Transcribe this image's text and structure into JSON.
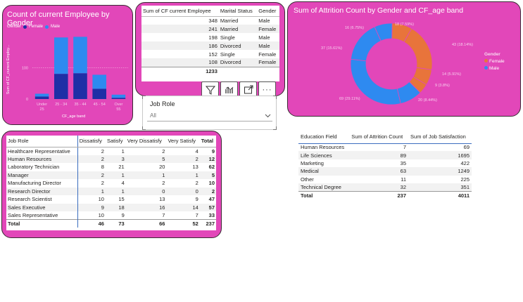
{
  "gender_chart": {
    "title": "Count of current Employee by Gender",
    "legend_title": "Gender",
    "legend": [
      {
        "name": "Female",
        "color": "#1f2fa6"
      },
      {
        "name": "Male",
        "color": "#2e8af0"
      }
    ],
    "ylabel": "Sum of CF_current Employ...",
    "xlabel": "CF_age band",
    "ytick_100": "100",
    "ytick_0": "0",
    "chart_data": {
      "type": "bar",
      "stacked": true,
      "title": "Count of current Employee by Gender",
      "xlabel": "CF_age band",
      "ylabel": "Sum of CF_current Employ...",
      "categories": [
        "Under 25",
        "25 - 34",
        "35 - 44",
        "45 - 54",
        "Over 55"
      ],
      "category_lines": [
        [
          "Under",
          "25"
        ],
        [
          "25 - 34",
          ""
        ],
        [
          "35 - 44",
          ""
        ],
        [
          "45 - 54",
          ""
        ],
        [
          "Over",
          "55"
        ]
      ],
      "series": [
        {
          "name": "Female",
          "color": "#1f2fa6",
          "values": [
            8,
            81,
            83,
            33,
            4
          ]
        },
        {
          "name": "Male",
          "color": "#2e8af0",
          "values": [
            9,
            117,
            117,
            45,
            10
          ]
        }
      ],
      "ylim": [
        0,
        210
      ],
      "grid": false,
      "legend_position": "top-left"
    }
  },
  "marital_table": {
    "headers": [
      "Sum of CF current Employee",
      "Marital Status",
      "Gender"
    ],
    "rows": [
      [
        "348",
        "Married",
        "Male"
      ],
      [
        "241",
        "Married",
        "Female"
      ],
      [
        "198",
        "Single",
        "Male"
      ],
      [
        "186",
        "Divorced",
        "Male"
      ],
      [
        "152",
        "Single",
        "Female"
      ],
      [
        "108",
        "Divorced",
        "Female"
      ]
    ],
    "total": "1233"
  },
  "visual_toolbar": {
    "filter_icon": "filter-icon",
    "analytics_icon": "analytics-icon",
    "focus_icon": "focus-mode-icon",
    "more_icon": "more-options-icon",
    "more_label": "···"
  },
  "attrition_chart": {
    "title": "Sum of Attrition Count by Gender and CF_age band",
    "legend_title": "Gender",
    "legend": [
      {
        "name": "Female",
        "color": "#e8743b"
      },
      {
        "name": "Male",
        "color": "#2e8af0"
      }
    ],
    "chart_data": {
      "type": "pie",
      "donut": true,
      "title": "Sum of Attrition Count by Gender and CF_age band",
      "slices": [
        {
          "label": "18 (7.59%)",
          "value": 18,
          "gender": "Female"
        },
        {
          "label": "43 (18.14%)",
          "value": 43,
          "gender": "Female"
        },
        {
          "label": "14 (5.91%)",
          "value": 14,
          "gender": "Female"
        },
        {
          "label": "9 (3.8%)",
          "value": 9,
          "gender": "Female"
        },
        {
          "label": "20 (8.44%)",
          "value": 20,
          "gender": "Male"
        },
        {
          "label": "69 (29.11%)",
          "value": 69,
          "gender": "Male"
        },
        {
          "label": "37 (15.61%)",
          "value": 37,
          "gender": "Male"
        },
        {
          "label": "16 (6.75%)",
          "value": 16,
          "gender": "Male"
        }
      ],
      "legend_position": "right"
    }
  },
  "job_role_slicer": {
    "title": "Job Role",
    "value": "All"
  },
  "job_table": {
    "headers": [
      "Job Role",
      "Dissatisfy",
      "Satisfy",
      "Very Dissatisfy",
      "Very Satisfy",
      "Total"
    ],
    "rows": [
      [
        "Healthcare Representative",
        "2",
        "1",
        "2",
        "4",
        "9"
      ],
      [
        "Human Resources",
        "2",
        "3",
        "5",
        "2",
        "12"
      ],
      [
        "Laboratory Technician",
        "8",
        "21",
        "20",
        "13",
        "62"
      ],
      [
        "Manager",
        "2",
        "1",
        "1",
        "1",
        "5"
      ],
      [
        "Manufacturing Director",
        "2",
        "4",
        "2",
        "2",
        "10"
      ],
      [
        "Research Director",
        "1",
        "1",
        "0",
        "0",
        "2"
      ],
      [
        "Research Scientist",
        "10",
        "15",
        "13",
        "9",
        "47"
      ],
      [
        "Sales Executive",
        "9",
        "18",
        "16",
        "14",
        "57"
      ],
      [
        "Sales Representative",
        "10",
        "9",
        "7",
        "7",
        "33"
      ]
    ],
    "total": [
      "Total",
      "46",
      "73",
      "66",
      "52",
      "237"
    ]
  },
  "education_table": {
    "headers": [
      "Education Field",
      "Sum of Attrition Count",
      "Sum of Job Satisfaction"
    ],
    "rows": [
      [
        "Human Resources",
        "7",
        "69"
      ],
      [
        "Life Sciences",
        "89",
        "1695"
      ],
      [
        "Marketing",
        "35",
        "422"
      ],
      [
        "Medical",
        "63",
        "1249"
      ],
      [
        "Other",
        "11",
        "225"
      ],
      [
        "Technical Degree",
        "32",
        "351"
      ]
    ],
    "total": [
      "Total",
      "237",
      "4011"
    ]
  }
}
